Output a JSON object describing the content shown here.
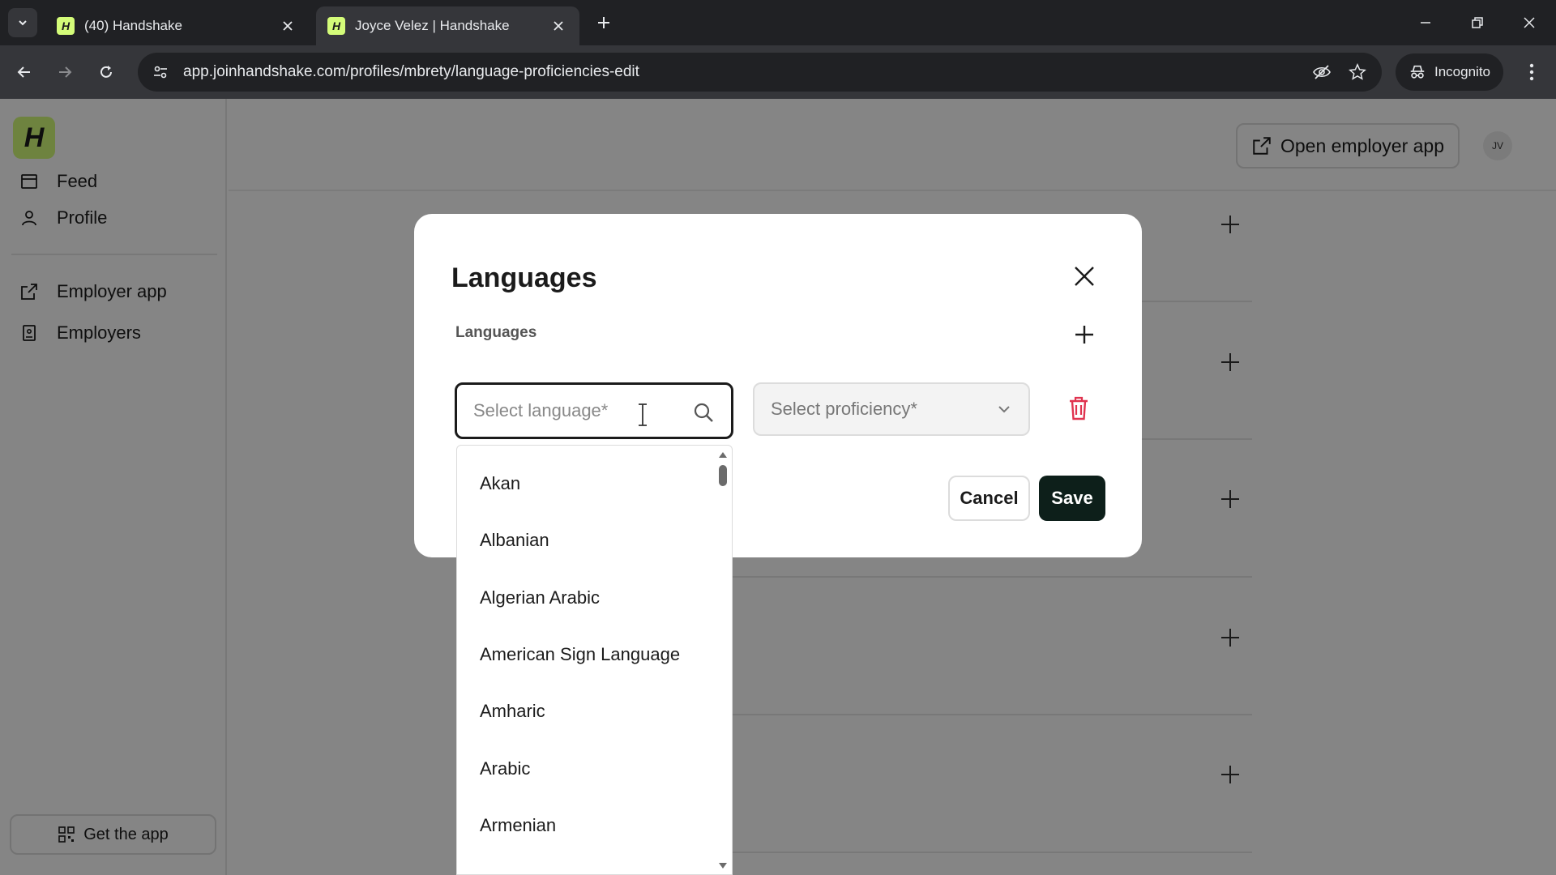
{
  "browser": {
    "tabs": [
      {
        "title": "(40) Handshake",
        "favicon": "H",
        "active": false
      },
      {
        "title": "Joyce Velez | Handshake",
        "favicon": "H",
        "active": true
      }
    ],
    "url": "app.joinhandshake.com/profiles/mbrety/language-proficiencies-edit",
    "incognito_label": "Incognito"
  },
  "sidebar": {
    "logo": "H",
    "items": [
      {
        "label": "Feed",
        "icon": "feed-icon"
      },
      {
        "label": "Profile",
        "icon": "person-icon"
      },
      {
        "label": "Employer app",
        "icon": "external-link-icon"
      },
      {
        "label": "Employers",
        "icon": "building-icon"
      }
    ],
    "get_app_label": "Get the app"
  },
  "header": {
    "open_employer_app_label": "Open employer app",
    "avatar_initials": "JV"
  },
  "modal": {
    "title": "Languages",
    "section_label": "Languages",
    "language_placeholder": "Select language*",
    "proficiency_placeholder": "Select proficiency*",
    "cancel_label": "Cancel",
    "save_label": "Save"
  },
  "dropdown": {
    "options": [
      "Akan",
      "Albanian",
      "Algerian Arabic",
      "American Sign Language",
      "Amharic",
      "Arabic",
      "Armenian"
    ]
  },
  "colors": {
    "brand_green": "#d4fc79",
    "save_button": "#0d1f1a",
    "delete_red": "#e0334f"
  }
}
